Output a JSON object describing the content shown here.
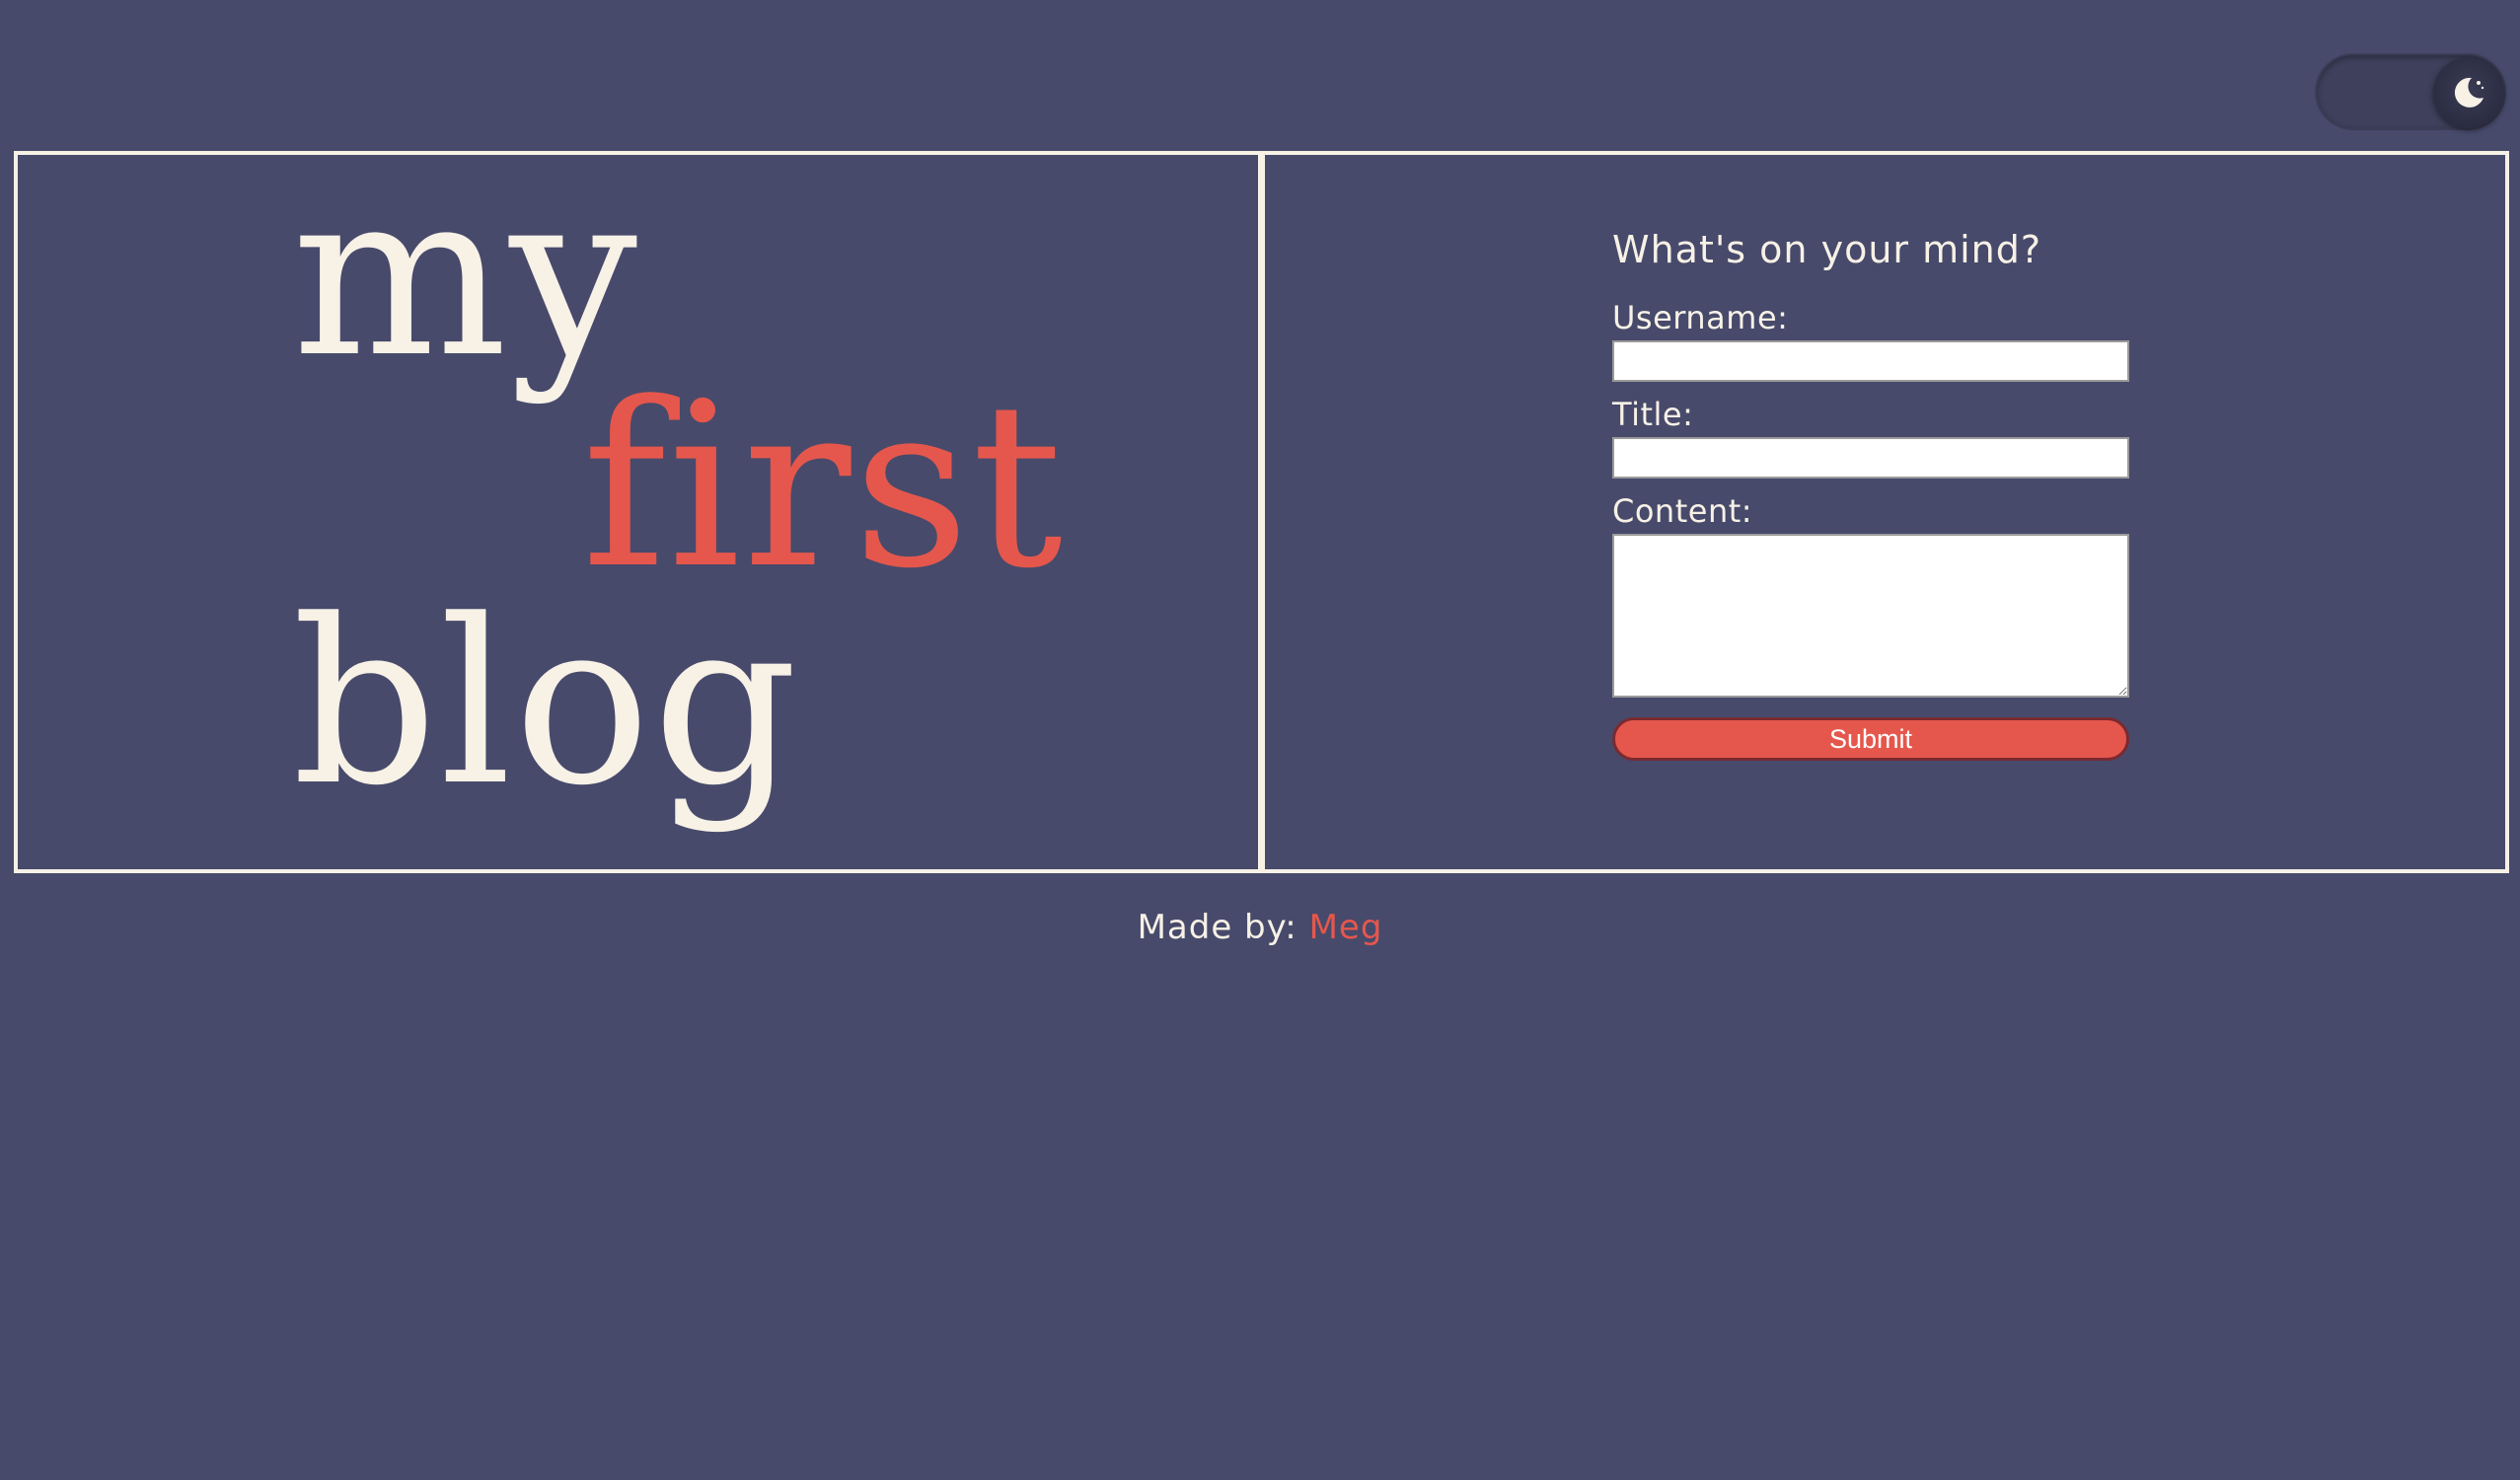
{
  "theme_toggle": {
    "icon": "moon-icon",
    "state": "dark"
  },
  "hero": {
    "word_1": "my",
    "word_2": "first",
    "word_3": "blog"
  },
  "form": {
    "heading": "What's on your mind?",
    "username_label": "Username:",
    "username_value": "",
    "title_label": "Title:",
    "title_value": "",
    "content_label": "Content:",
    "content_value": "",
    "submit_label": "Submit"
  },
  "footer": {
    "prefix": "Made by:",
    "author": "Meg"
  },
  "colors": {
    "background": "#474a6b",
    "text": "#f7f1e6",
    "accent": "#e5574c"
  }
}
